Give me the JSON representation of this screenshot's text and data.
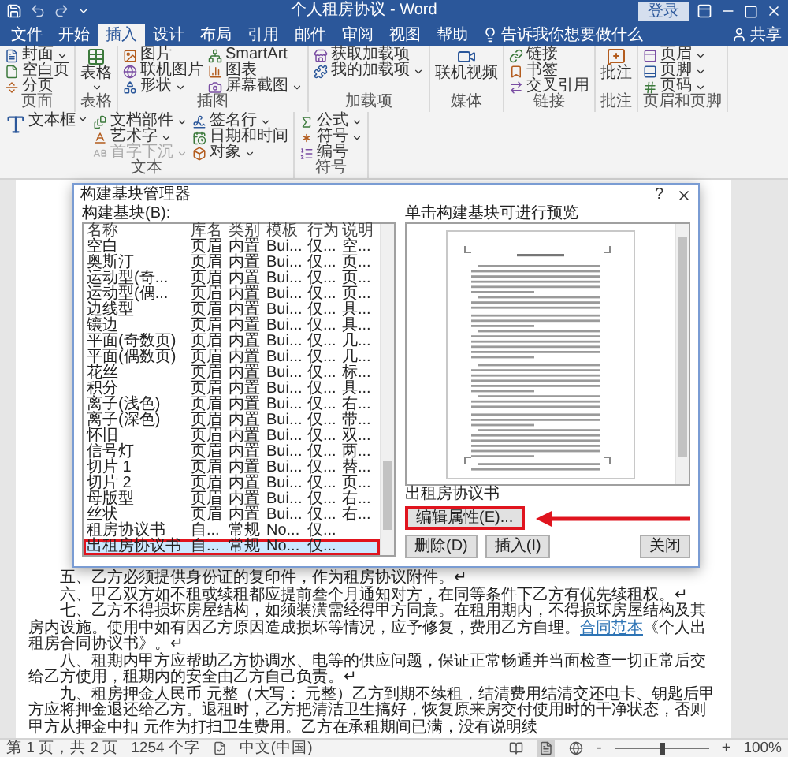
{
  "window": {
    "title": "个人租房协议 - Word",
    "sign_in": "登录"
  },
  "tabs": [
    {
      "label": "文件",
      "selected": false
    },
    {
      "label": "开始",
      "selected": false
    },
    {
      "label": "插入",
      "selected": true
    },
    {
      "label": "设计",
      "selected": false
    },
    {
      "label": "布局",
      "selected": false
    },
    {
      "label": "引用",
      "selected": false
    },
    {
      "label": "邮件",
      "selected": false
    },
    {
      "label": "审阅",
      "selected": false
    },
    {
      "label": "视图",
      "selected": false
    },
    {
      "label": "帮助",
      "selected": false
    }
  ],
  "tell_me": "告诉我你想要做什么",
  "share": "共享",
  "ribbon": {
    "groups": [
      {
        "label": "页面",
        "items": [
          {
            "label": "封面",
            "kind": "small",
            "menu": true,
            "disabled": false
          },
          {
            "label": "空白页",
            "kind": "small",
            "menu": false,
            "disabled": false
          },
          {
            "label": "分页",
            "kind": "small",
            "menu": false,
            "disabled": false
          }
        ]
      },
      {
        "label": "表格",
        "items": [
          {
            "label": "表格",
            "kind": "large",
            "menu": true,
            "disabled": false
          }
        ]
      },
      {
        "label": "插图",
        "items": [
          {
            "label": "图片",
            "kind": "small",
            "menu": false,
            "disabled": false
          },
          {
            "label": "联机图片",
            "kind": "small",
            "menu": false,
            "disabled": false
          },
          {
            "label": "形状",
            "kind": "small",
            "menu": true,
            "disabled": false
          },
          {
            "label": "SmartArt",
            "kind": "small",
            "menu": false,
            "disabled": false
          },
          {
            "label": "图表",
            "kind": "small",
            "menu": false,
            "disabled": false
          },
          {
            "label": "屏幕截图",
            "kind": "small",
            "menu": true,
            "disabled": false
          }
        ]
      },
      {
        "label": "加载项",
        "items": [
          {
            "label": "获取加载项",
            "kind": "small",
            "menu": false,
            "disabled": false
          },
          {
            "label": "我的加载项",
            "kind": "small",
            "menu": true,
            "disabled": false
          }
        ]
      },
      {
        "label": "媒体",
        "items": [
          {
            "label": "联机视频",
            "kind": "large",
            "menu": false,
            "disabled": false
          }
        ]
      },
      {
        "label": "链接",
        "items": [
          {
            "label": "链接",
            "kind": "small",
            "menu": false,
            "disabled": false
          },
          {
            "label": "书签",
            "kind": "small",
            "menu": false,
            "disabled": false
          },
          {
            "label": "交叉引用",
            "kind": "small",
            "menu": false,
            "disabled": false
          }
        ]
      },
      {
        "label": "批注",
        "items": [
          {
            "label": "批注",
            "kind": "large",
            "menu": false,
            "disabled": false
          }
        ]
      },
      {
        "label": "页眉和页脚",
        "items": [
          {
            "label": "页眉",
            "kind": "small",
            "menu": true,
            "disabled": false
          },
          {
            "label": "页脚",
            "kind": "small",
            "menu": true,
            "disabled": false
          },
          {
            "label": "页码",
            "kind": "small",
            "menu": true,
            "disabled": false
          }
        ]
      },
      {
        "label": "文本",
        "items": [
          {
            "label": "文本框",
            "kind": "large",
            "menu": true,
            "disabled": false
          },
          {
            "label": "文档部件",
            "kind": "small",
            "menu": true,
            "disabled": false
          },
          {
            "label": "艺术字",
            "kind": "small",
            "menu": true,
            "disabled": false
          },
          {
            "label": "首字下沉",
            "kind": "small",
            "menu": true,
            "disabled": true
          },
          {
            "label": "签名行",
            "kind": "small",
            "menu": true,
            "disabled": false
          },
          {
            "label": "日期和时间",
            "kind": "small",
            "menu": false,
            "disabled": false
          },
          {
            "label": "对象",
            "kind": "small",
            "menu": true,
            "disabled": false
          }
        ]
      },
      {
        "label": "符号",
        "items": [
          {
            "label": "公式",
            "kind": "small",
            "menu": true,
            "disabled": false
          },
          {
            "label": "符号",
            "kind": "small",
            "menu": true,
            "disabled": false
          },
          {
            "label": "编号",
            "kind": "small",
            "menu": false,
            "disabled": false
          }
        ]
      }
    ]
  },
  "dialog": {
    "title": "构建基块管理器",
    "help": "?",
    "list_label": "构建基块(B):",
    "columns": [
      "名称",
      "库名",
      "类别",
      "模板",
      "行为",
      "说明"
    ],
    "rows": [
      {
        "cells": [
          "空白",
          "页眉",
          "内置",
          "Bui...",
          "仅...",
          "空..."
        ],
        "selected": false,
        "highlighted": false
      },
      {
        "cells": [
          "奥斯汀",
          "页眉",
          "内置",
          "Bui...",
          "仅...",
          "页..."
        ],
        "selected": false,
        "highlighted": false
      },
      {
        "cells": [
          "运动型(奇...",
          "页眉",
          "内置",
          "Bui...",
          "仅...",
          "页..."
        ],
        "selected": false,
        "highlighted": false
      },
      {
        "cells": [
          "运动型(偶...",
          "页眉",
          "内置",
          "Bui...",
          "仅...",
          "页..."
        ],
        "selected": false,
        "highlighted": false
      },
      {
        "cells": [
          "边线型",
          "页眉",
          "内置",
          "Bui...",
          "仅...",
          "具..."
        ],
        "selected": false,
        "highlighted": false
      },
      {
        "cells": [
          "镶边",
          "页眉",
          "内置",
          "Bui...",
          "仅...",
          "具..."
        ],
        "selected": false,
        "highlighted": false
      },
      {
        "cells": [
          "平面(奇数页)",
          "页眉",
          "内置",
          "Bui...",
          "仅...",
          "几..."
        ],
        "selected": false,
        "highlighted": false
      },
      {
        "cells": [
          "平面(偶数页)",
          "页眉",
          "内置",
          "Bui...",
          "仅...",
          "几..."
        ],
        "selected": false,
        "highlighted": false
      },
      {
        "cells": [
          "花丝",
          "页眉",
          "内置",
          "Bui...",
          "仅...",
          "标..."
        ],
        "selected": false,
        "highlighted": false
      },
      {
        "cells": [
          "积分",
          "页眉",
          "内置",
          "Bui...",
          "仅...",
          "具..."
        ],
        "selected": false,
        "highlighted": false
      },
      {
        "cells": [
          "离子(浅色)",
          "页眉",
          "内置",
          "Bui...",
          "仅...",
          "右..."
        ],
        "selected": false,
        "highlighted": false
      },
      {
        "cells": [
          "离子(深色)",
          "页眉",
          "内置",
          "Bui...",
          "仅...",
          "带..."
        ],
        "selected": false,
        "highlighted": false
      },
      {
        "cells": [
          "怀旧",
          "页眉",
          "内置",
          "Bui...",
          "仅...",
          "双..."
        ],
        "selected": false,
        "highlighted": false
      },
      {
        "cells": [
          "信号灯",
          "页眉",
          "内置",
          "Bui...",
          "仅...",
          "两..."
        ],
        "selected": false,
        "highlighted": false
      },
      {
        "cells": [
          "切片 1",
          "页眉",
          "内置",
          "Bui...",
          "仅...",
          "替..."
        ],
        "selected": false,
        "highlighted": false
      },
      {
        "cells": [
          "切片 2",
          "页眉",
          "内置",
          "Bui...",
          "仅...",
          "页..."
        ],
        "selected": false,
        "highlighted": false
      },
      {
        "cells": [
          "母版型",
          "页眉",
          "内置",
          "Bui...",
          "仅...",
          "右..."
        ],
        "selected": false,
        "highlighted": false
      },
      {
        "cells": [
          "丝状",
          "页眉",
          "内置",
          "Bui...",
          "仅...",
          "右..."
        ],
        "selected": false,
        "highlighted": false
      },
      {
        "cells": [
          "租房协议书",
          "自...",
          "常规",
          "No...",
          "仅..."
        ],
        "selected": false,
        "highlighted": false
      },
      {
        "cells": [
          "出租房协议书",
          "自...",
          "常规",
          "No...",
          "仅..."
        ],
        "selected": true,
        "highlighted": true
      }
    ],
    "preview_label": "单击构建基块可进行预览",
    "preview_caption": "出租房协议书",
    "buttons": [
      {
        "label": "编辑属性(E)...",
        "highlighted": true
      },
      {
        "label": "删除(D)",
        "highlighted": false
      },
      {
        "label": "插入(I)",
        "highlighted": false
      }
    ],
    "close": "关闭"
  },
  "document": {
    "paragraphs": [
      {
        "parts": [
          {
            "kind": "text",
            "text": "五、乙方必须提供身份证的复印件，作为租房协议附件。↵"
          }
        ]
      },
      {
        "parts": [
          {
            "kind": "text",
            "text": "六、甲乙双方如不租或续租都应提前叁个月通知对方，在同等条件下乙方有优先续租权。↵"
          }
        ]
      },
      {
        "parts": [
          {
            "kind": "text",
            "text": "七、乙方不得损坏房屋结构，如须装潢需经得甲方同意。在租用期内，不得损坏房屋结构及其房内设施。使用中如有因乙方原因造成损坏等情况，应予修复，费用乙方自理。"
          },
          {
            "kind": "link",
            "text": "合同范本"
          },
          {
            "kind": "text",
            "text": "《个人出租房合同协议书》。↵"
          }
        ]
      },
      {
        "parts": [
          {
            "kind": "text",
            "text": "八、租期内甲方应帮助乙方协调水、电等的供应问题，保证正常畅通并当面检查一切正常后交给乙方使用，租期内的安全由乙方自己负责。↵"
          }
        ]
      },
      {
        "parts": [
          {
            "kind": "text",
            "text": "九、租房押金人民币 元整（大写： 元整）乙方到期不续租，结清费用结清交还电卡、钥匙后甲方应将押金退还给乙方。退租时，乙方把清洁卫生搞好，恢复原来房交付使用时的干净状态，否则甲方从押金中扣 元作为打扫卫生费用。乙方在承租期间已满，没有说明续"
          }
        ]
      }
    ]
  },
  "status_bar": {
    "page": "第 1 页，共 2 页",
    "words": "1254 个字",
    "language": "中文(中国)",
    "views": [
      {
        "selected": false
      },
      {
        "selected": true
      },
      {
        "selected": false
      }
    ],
    "zoom_out": "-",
    "zoom_in": "+",
    "zoom": {
      "level": 0.5
    },
    "zoom_label": "100%"
  }
}
